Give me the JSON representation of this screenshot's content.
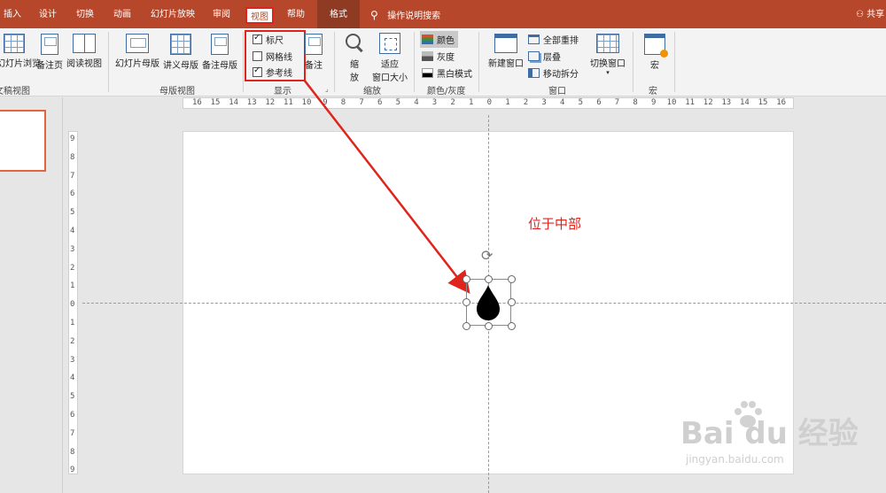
{
  "tabs": {
    "insert": "插入",
    "design": "设计",
    "transitions": "切换",
    "animations": "动画",
    "slideshow": "幻灯片放映",
    "review": "审阅",
    "view": "视图",
    "help": "帮助",
    "format": "格式",
    "tell_me": "操作说明搜索",
    "share": "共享"
  },
  "ribbon": {
    "presentation_views": {
      "label": "文稿视图",
      "slide_sorter": "幻灯片浏览",
      "notes_page": "备注页",
      "reading_view": "阅读视图"
    },
    "master_views": {
      "label": "母版视图",
      "slide_master": "幻灯片母版",
      "handout_master": "讲义母版",
      "notes_master": "备注母版"
    },
    "show": {
      "label": "显示",
      "ruler": "标尺",
      "ruler_checked": true,
      "gridlines": "网格线",
      "gridlines_checked": false,
      "guides": "参考线",
      "guides_checked": true,
      "notes": "备注"
    },
    "zoom": {
      "label": "缩放",
      "zoom_line1": "缩",
      "zoom_line2": "放",
      "fit_line1": "适应",
      "fit_line2": "窗口大小"
    },
    "color": {
      "label": "颜色/灰度",
      "color": "颜色",
      "grayscale": "灰度",
      "black_white": "黑白模式"
    },
    "window": {
      "label": "窗口",
      "new_window": "新建窗口",
      "arrange_all": "全部重排",
      "cascade": "层叠",
      "move_split": "移动拆分",
      "switch_windows": "切换窗口"
    },
    "macros": {
      "label": "宏",
      "macros": "宏"
    }
  },
  "ruler": {
    "horizontal": [
      "16",
      "15",
      "14",
      "13",
      "12",
      "11",
      "10",
      "9",
      "8",
      "7",
      "6",
      "5",
      "4",
      "3",
      "2",
      "1",
      "0",
      "1",
      "2",
      "3",
      "4",
      "5",
      "6",
      "7",
      "8",
      "9",
      "10",
      "11",
      "12",
      "13",
      "14",
      "15",
      "16"
    ],
    "vertical": [
      "9",
      "8",
      "7",
      "6",
      "5",
      "4",
      "3",
      "2",
      "1",
      "0",
      "1",
      "2",
      "3",
      "4",
      "5",
      "6",
      "7",
      "8",
      "9"
    ]
  },
  "slide": {
    "annotation": "位于中部"
  },
  "watermark": {
    "brand": "Bai du 经验",
    "url": "jingyan.baidu.com"
  },
  "colors": {
    "accent": "#b7472a",
    "highlight": "#e0231b",
    "ruler_bg": "#ffffff"
  }
}
